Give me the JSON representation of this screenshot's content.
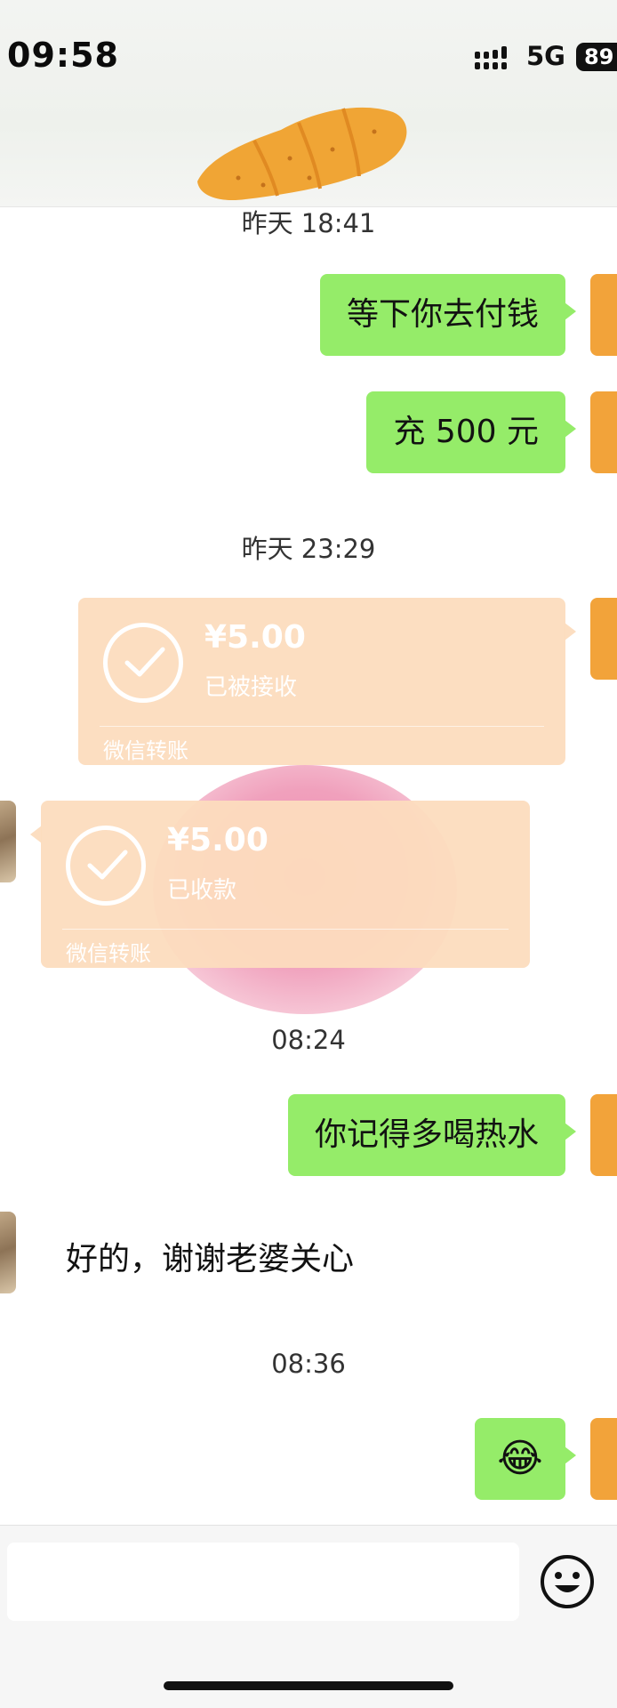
{
  "status_bar": {
    "time": "09:58",
    "network": "5G",
    "battery": "89"
  },
  "colors": {
    "my_bubble": "#95ec69",
    "transfer_card": "#fcdcbe",
    "avatar_orange": "#f2a33a"
  },
  "messages": {
    "ts1": "昨天 18:41",
    "m1": "等下你去付钱",
    "m2": "充 500 元",
    "ts2": "昨天 23:29",
    "transfer_sent": {
      "amount": "¥5.00",
      "status": "已被接收",
      "brand": "微信转账"
    },
    "transfer_received": {
      "amount": "¥5.00",
      "status": "已收款",
      "brand": "微信转账"
    },
    "ts3": "08:24",
    "m3": "你记得多喝热水",
    "reply": "好的，谢谢老婆关心",
    "ts4": "08:36",
    "emoji": "😂"
  },
  "icons": {
    "transfer": "check-circle-icon",
    "input_emoji": "smiley-icon",
    "header_sticker": "croissant-icon"
  }
}
